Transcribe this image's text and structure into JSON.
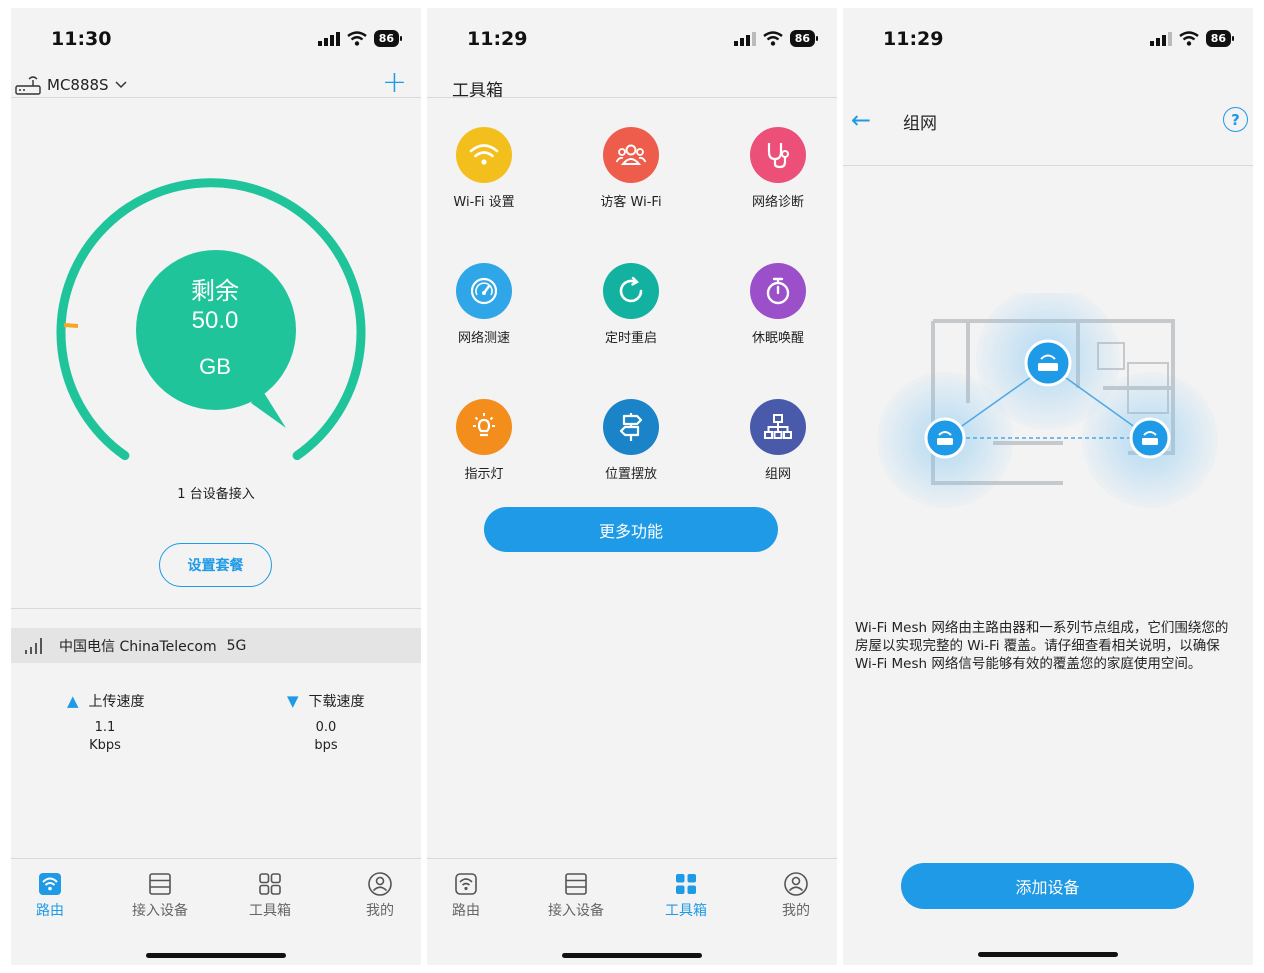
{
  "colors": {
    "accent": "#1e9ae6",
    "gauge": "#1fc49a",
    "page_bg": "#f3f3f3"
  },
  "status": {
    "p1_time": "11:30",
    "p2_time": "11:29",
    "p3_time": "11:29",
    "battery": "86"
  },
  "router_screen": {
    "router_name": "MC888S",
    "plus_icon": "plus-icon",
    "gauge": {
      "line1": "剩余",
      "line2": "50.0",
      "line3": "GB",
      "remaining_fraction": 0.97
    },
    "devices_text": "1 台设备接入",
    "set_plan_label": "设置套餐",
    "carrier": {
      "name": "中国电信 ChinaTelecom",
      "network": "5G"
    },
    "upload": {
      "label": "上传速度",
      "value": "1.1",
      "unit": "Kbps"
    },
    "download": {
      "label": "下载速度",
      "value": "0.0",
      "unit": "bps"
    }
  },
  "nav": {
    "router": "路由",
    "devices": "接入设备",
    "toolbox": "工具箱",
    "mine": "我的"
  },
  "toolbox_screen": {
    "title": "工具箱",
    "tools": [
      {
        "label": "Wi-Fi 设置",
        "icon": "wifi-icon",
        "color": "#f3bf1d"
      },
      {
        "label": "访客 Wi-Fi",
        "icon": "guests-icon",
        "color": "#ee5d4b"
      },
      {
        "label": "网络诊断",
        "icon": "stethoscope-icon",
        "color": "#ec4f78"
      },
      {
        "label": "网络测速",
        "icon": "speedometer-icon",
        "color": "#2fa6e8"
      },
      {
        "label": "定时重启",
        "icon": "restart-icon",
        "color": "#13b2a0"
      },
      {
        "label": "休眠唤醒",
        "icon": "stopwatch-icon",
        "color": "#9b4fc9"
      },
      {
        "label": "指示灯",
        "icon": "bulb-icon",
        "color": "#f38d1b"
      },
      {
        "label": "位置摆放",
        "icon": "signpost-icon",
        "color": "#1b84c8"
      },
      {
        "label": "组网",
        "icon": "network-icon",
        "color": "#4a5aab"
      }
    ],
    "more_label": "更多功能"
  },
  "mesh_screen": {
    "title": "组网",
    "description": "Wi-Fi Mesh 网络由主路由器和一系列节点组成，它们围绕您的房屋以实现完整的 Wi-Fi 覆盖。请仔细查看相关说明，以确保 Wi-Fi Mesh 网络信号能够有效的覆盖您的家庭使用空间。",
    "add_device_label": "添加设备"
  }
}
